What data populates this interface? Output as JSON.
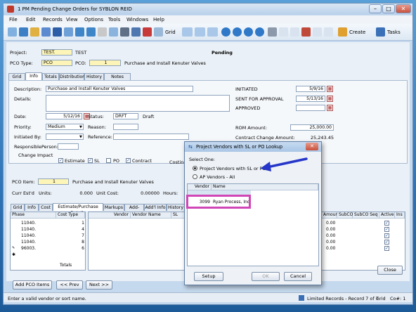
{
  "window": {
    "title": "1 PM Pending Change Orders for SYBLON REID"
  },
  "menu": [
    "File",
    "Edit",
    "Records",
    "View",
    "Options",
    "Tools",
    "Windows",
    "Help"
  ],
  "toolbar": {
    "grid_label": "Grid",
    "create_label": "Create",
    "tasks_label": "Tasks"
  },
  "header": {
    "project_label": "Project:",
    "project_value": "TEST.",
    "project_name": "TEST",
    "status_text": "Pending",
    "pco_type_label": "PCO Type:",
    "pco_type_value": "PCO",
    "pco_label": "PCO:",
    "pco_value": "1",
    "pco_desc": "Purchase and Install Kenuter Valves"
  },
  "top_tabs": [
    "Grid",
    "Info",
    "Totals",
    "Distribution",
    "History",
    "Notes"
  ],
  "info": {
    "description_label": "Description:",
    "description_value": "Purchase and Install Kenuter Valves",
    "details_label": "Details:",
    "date_label": "Date:",
    "date_value": "5/12/16",
    "status_label": "Status:",
    "status_value": "DRFT",
    "status_desc": "Draft",
    "priority_label": "Priority:",
    "priority_value": "Medium",
    "reason_label": "Reason:",
    "initiated_by_label": "Initiated By:",
    "reference_label": "Reference:",
    "responsible_label": "ResponsiblePerson:",
    "change_impact_label": "Change Impact",
    "estimate_label": "Estimate",
    "sl_label": "SL",
    "po_label": "PO",
    "contract_label": "Contract",
    "costing_label": "Costing M",
    "initiated_label": "INITIATED",
    "initiated_value": "5/9/16",
    "sent_label": "SENT FOR APPROVAL",
    "sent_value": "5/13/16",
    "approved_label": "APPROVED",
    "rom_label": "ROM Amount:",
    "rom_value": "25,000.00",
    "contract_change_label": "Contract Change Amount:",
    "contract_change_value": "25,243.45"
  },
  "item": {
    "pco_item_label": "PCO Item:",
    "pco_item_value": "1",
    "pco_item_desc": "Purchase and Install Kenuter Valves",
    "curr_est_label": "Curr Est'd",
    "units_label": "Units:",
    "units_value": "0.000",
    "unit_cost_label": "Unit Cost:",
    "unit_cost_value": "0.00000",
    "hours_label": "Hours:"
  },
  "bottom_tabs": [
    "Grid",
    "Info",
    "Cost",
    "Estimate/Purchase Details",
    "Markups",
    "Add-Ons",
    "Add'l Info",
    "History"
  ],
  "left_grid": {
    "headers": [
      "Phase",
      "Cost Type"
    ],
    "rows": [
      [
        "11040.",
        "1"
      ],
      [
        "11040.",
        "4"
      ],
      [
        "11040.",
        "7"
      ],
      [
        "11040.",
        "8"
      ],
      [
        "96003.",
        "6"
      ]
    ],
    "totals_label": "Totals"
  },
  "right_grid": {
    "headers": [
      "Vendor",
      "Vendor Name",
      "SL"
    ]
  },
  "far_grid": {
    "headers": [
      "Amount",
      "SubCO",
      "SubCO Seq",
      "Active",
      "Ins"
    ],
    "rows": [
      [
        "0.00"
      ],
      [
        "0.00"
      ],
      [
        "0.00"
      ],
      [
        "0.00"
      ],
      [
        "0.00"
      ]
    ]
  },
  "buttons": {
    "add_items": "Add PCO Items",
    "prev": "<< Prev",
    "next": "Next >>",
    "close": "Close"
  },
  "dialog": {
    "title": "Project Vendors with SL or PO Lookup",
    "select_one": "Select One:",
    "option1": "Project Vendors with SL or PO",
    "option2": "AP Vendors - All",
    "col_vendor": "Vendor",
    "col_name": "Name",
    "row_vendor": "3099",
    "row_name": "Ryan Process, Inc.",
    "setup": "Setup",
    "ok": "OK",
    "cancel": "Cancel"
  },
  "status": {
    "message": "Enter a valid vendor or sort name.",
    "records": "Limited Records - Record 7 of 7",
    "grid": "Grid",
    "co": "Co#: 1"
  },
  "colors": {
    "highlight_box": "#d146b6",
    "arrow": "#2636c8",
    "field_yellow": "#fdf5b7"
  }
}
